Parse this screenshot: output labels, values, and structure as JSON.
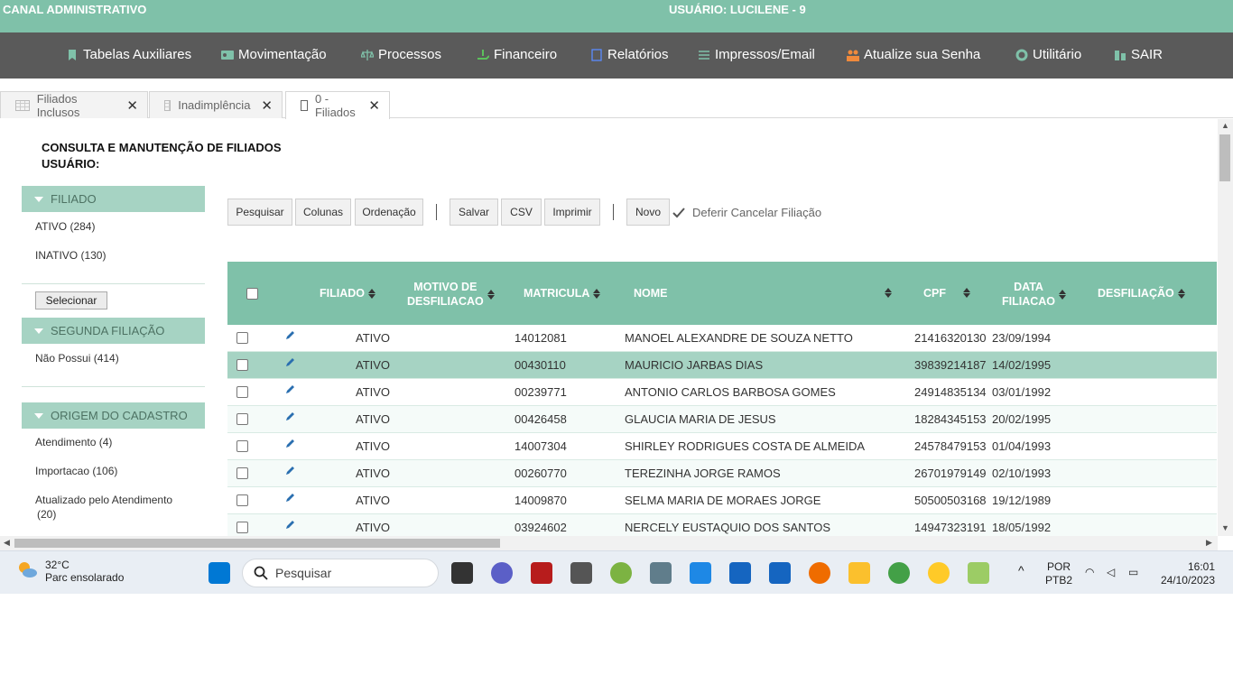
{
  "topbar": {
    "left": "CANAL ADMINISTRATIVO",
    "center": "USUÁRIO: LUCILENE - 9"
  },
  "nav": [
    {
      "label": "Tabelas Auxiliares",
      "icon": "bookmark-icon"
    },
    {
      "label": "Movimentação",
      "icon": "id-card-icon"
    },
    {
      "label": "Processos",
      "icon": "balance-scale-icon"
    },
    {
      "label": "Financeiro",
      "icon": "money-hand-icon"
    },
    {
      "label": "Relatórios",
      "icon": "document-icon"
    },
    {
      "label": "Impressos/Email",
      "icon": "list-icon"
    },
    {
      "label": "Atualize sua Senha",
      "icon": "users-icon"
    },
    {
      "label": "Utilitário",
      "icon": "gear-icon"
    },
    {
      "label": "SAIR",
      "icon": "building-icon"
    }
  ],
  "tabs": [
    {
      "label": "Filiados Inclusos"
    },
    {
      "label": "Inadimplência"
    },
    {
      "label": "0 - Filiados"
    }
  ],
  "page": {
    "title": "CONSULTA E MANUTENÇÃO DE FILIADOS",
    "user_line": "USUÁRIO:"
  },
  "filters": {
    "filiado": {
      "title": "FILIADO",
      "items": [
        "ATIVO  (284)",
        "INATIVO  (130)"
      ],
      "select_button": "Selecionar"
    },
    "segunda": {
      "title": "SEGUNDA FILIAÇÃO",
      "items": [
        "Não Possui  (414)"
      ]
    },
    "origem": {
      "title": "ORIGEM DO CADASTRO",
      "items": [
        "Atendimento  (4)",
        "Importacao  (106)",
        "Atualizado pelo Atendimento",
        "(20)"
      ]
    }
  },
  "toolbar": {
    "pesquisar": "Pesquisar",
    "colunas": "Colunas",
    "ordenacao": "Ordenação",
    "salvar": "Salvar",
    "csv": "CSV",
    "imprimir": "Imprimir",
    "novo": "Novo",
    "deferir": "Deferir Cancelar Filiação"
  },
  "table": {
    "headers": {
      "filiado": "FILIADO",
      "motivo1": "MOTIVO DE",
      "motivo2": "DESFILIACAO",
      "matricula": "MATRICULA",
      "nome": "NOME",
      "cpf": "CPF",
      "data1": "DATA",
      "data2": "FILIACAO",
      "desfiliacao": "DESFILIAÇÃO"
    },
    "rows": [
      {
        "status": "ATIVO",
        "matricula": "14012081",
        "nome": "MANOEL ALEXANDRE DE SOUZA NETTO",
        "cpf": "21416320130",
        "data": "23/09/1994"
      },
      {
        "status": "ATIVO",
        "matricula": "00430110",
        "nome": "MAURICIO JARBAS DIAS",
        "cpf": "39839214187",
        "data": "14/02/1995"
      },
      {
        "status": "ATIVO",
        "matricula": "00239771",
        "nome": "ANTONIO CARLOS BARBOSA GOMES",
        "cpf": "24914835134",
        "data": "03/01/1992"
      },
      {
        "status": "ATIVO",
        "matricula": "00426458",
        "nome": "GLAUCIA MARIA DE JESUS",
        "cpf": "18284345153",
        "data": "20/02/1995"
      },
      {
        "status": "ATIVO",
        "matricula": "14007304",
        "nome": "SHIRLEY RODRIGUES COSTA DE ALMEIDA",
        "cpf": "24578479153",
        "data": "01/04/1993"
      },
      {
        "status": "ATIVO",
        "matricula": "00260770",
        "nome": "TEREZINHA JORGE RAMOS",
        "cpf": "26701979149",
        "data": "02/10/1993"
      },
      {
        "status": "ATIVO",
        "matricula": "14009870",
        "nome": "SELMA MARIA DE MORAES JORGE",
        "cpf": "50500503168",
        "data": "19/12/1989"
      },
      {
        "status": "ATIVO",
        "matricula": "03924602",
        "nome": "NERCELY EUSTAQUIO DOS SANTOS",
        "cpf": "14947323191",
        "data": "18/05/1992"
      }
    ]
  },
  "taskbar": {
    "temp": "32°C",
    "weather": "Parc ensolarado",
    "search": "Pesquisar",
    "lang1": "POR",
    "lang2": "PTB2",
    "time": "16:01",
    "date": "24/10/2023"
  },
  "colors": {
    "accent": "#7fc1a9",
    "nav_bg": "#5a5a5a",
    "selected_row": "#a6d3c3"
  }
}
